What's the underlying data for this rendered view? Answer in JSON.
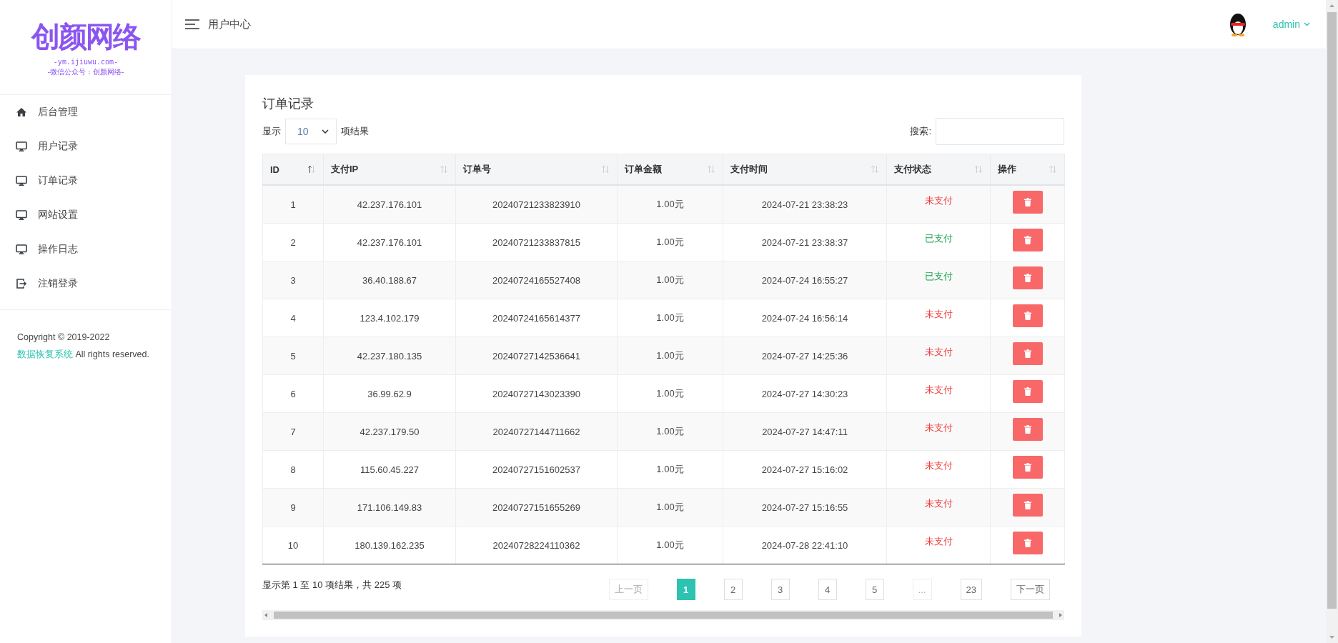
{
  "logo": {
    "title": "创颜网络",
    "domain": "-ym.ijiuwu.com-",
    "subtitle": "-微信公众号：创颜网络-"
  },
  "sidebar": {
    "items": [
      {
        "label": "后台管理",
        "kind": "home",
        "selected": false
      },
      {
        "label": "用户记录",
        "kind": "monitor",
        "selected": false
      },
      {
        "label": "订单记录",
        "kind": "monitor",
        "selected": false
      },
      {
        "label": "网站设置",
        "kind": "monitor",
        "selected": false
      },
      {
        "label": "操作日志",
        "kind": "monitor",
        "selected": false
      },
      {
        "label": "注销登录",
        "kind": "logout",
        "selected": false
      }
    ],
    "footer": {
      "prefix": "Copyright © 2019-2022 ",
      "link": "数据恢复系统",
      "suffix": " All rights reserved."
    }
  },
  "header": {
    "title": "用户中心",
    "user": "admin"
  },
  "card": {
    "title": "订单记录",
    "length": {
      "before": "显示",
      "value": "10",
      "after": "项结果"
    },
    "search": {
      "label": "搜索:"
    }
  },
  "table": {
    "columns": [
      {
        "label": "ID",
        "sorted": true
      },
      {
        "label": "支付IP",
        "sorted": false
      },
      {
        "label": "订单号",
        "sorted": false
      },
      {
        "label": "订单金额",
        "sorted": false
      },
      {
        "label": "支付时间",
        "sorted": false
      },
      {
        "label": "支付状态",
        "sorted": false
      },
      {
        "label": "操作",
        "sorted": false
      }
    ],
    "rows": [
      {
        "id": "1",
        "ip": "42.237.176.101",
        "order": "20240721233823910",
        "amount": "1.00元",
        "time": "2024-07-21 23:38:23",
        "status": "未支付",
        "paid": false
      },
      {
        "id": "2",
        "ip": "42.237.176.101",
        "order": "20240721233837815",
        "amount": "1.00元",
        "time": "2024-07-21 23:38:37",
        "status": "已支付",
        "paid": true
      },
      {
        "id": "3",
        "ip": "36.40.188.67",
        "order": "20240724165527408",
        "amount": "1.00元",
        "time": "2024-07-24 16:55:27",
        "status": "已支付",
        "paid": true
      },
      {
        "id": "4",
        "ip": "123.4.102.179",
        "order": "20240724165614377",
        "amount": "1.00元",
        "time": "2024-07-24 16:56:14",
        "status": "未支付",
        "paid": false
      },
      {
        "id": "5",
        "ip": "42.237.180.135",
        "order": "20240727142536641",
        "amount": "1.00元",
        "time": "2024-07-27 14:25:36",
        "status": "未支付",
        "paid": false
      },
      {
        "id": "6",
        "ip": "36.99.62.9",
        "order": "20240727143023390",
        "amount": "1.00元",
        "time": "2024-07-27 14:30:23",
        "status": "未支付",
        "paid": false
      },
      {
        "id": "7",
        "ip": "42.237.179.50",
        "order": "20240727144711662",
        "amount": "1.00元",
        "time": "2024-07-27 14:47:11",
        "status": "未支付",
        "paid": false
      },
      {
        "id": "8",
        "ip": "115.60.45.227",
        "order": "20240727151602537",
        "amount": "1.00元",
        "time": "2024-07-27 15:16:02",
        "status": "未支付",
        "paid": false
      },
      {
        "id": "9",
        "ip": "171.106.149.83",
        "order": "20240727151655269",
        "amount": "1.00元",
        "time": "2024-07-27 15:16:55",
        "status": "未支付",
        "paid": false
      },
      {
        "id": "10",
        "ip": "180.139.162.235",
        "order": "20240728224110362",
        "amount": "1.00元",
        "time": "2024-07-28 22:41:10",
        "status": "未支付",
        "paid": false
      }
    ]
  },
  "info": "显示第 1 至 10 项结果，共 225 项",
  "pagination": [
    {
      "label": "上一页",
      "selected": false,
      "disabled": true
    },
    {
      "label": "1",
      "selected": true,
      "disabled": false
    },
    {
      "label": "2",
      "selected": false,
      "disabled": false
    },
    {
      "label": "3",
      "selected": false,
      "disabled": false
    },
    {
      "label": "4",
      "selected": false,
      "disabled": false
    },
    {
      "label": "5",
      "selected": false,
      "disabled": false
    },
    {
      "label": "...",
      "selected": false,
      "disabled": true
    },
    {
      "label": "23",
      "selected": false,
      "disabled": false
    },
    {
      "label": "下一页",
      "selected": false,
      "disabled": false
    }
  ]
}
